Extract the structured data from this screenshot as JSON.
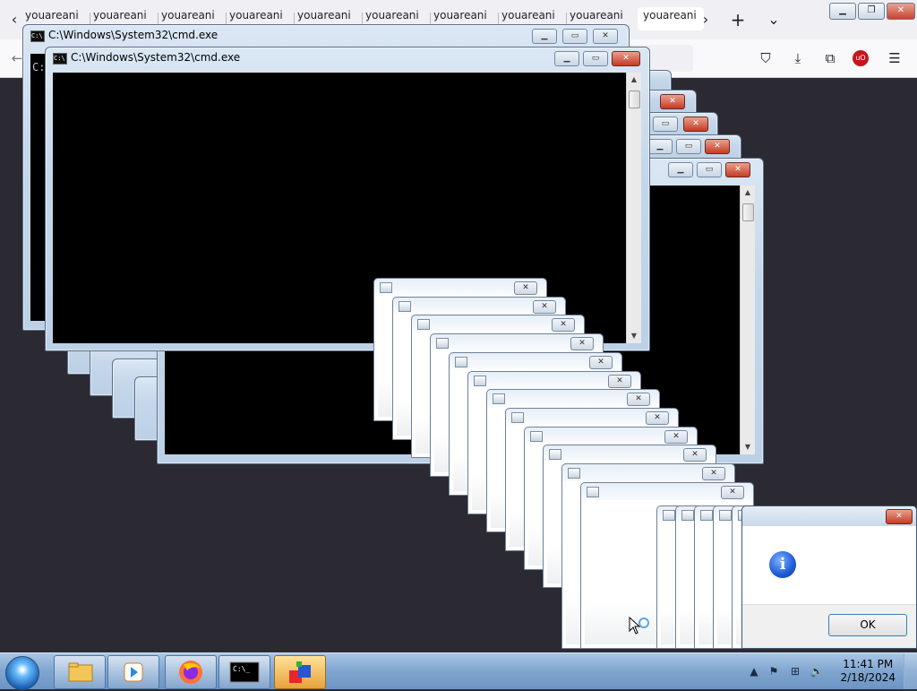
{
  "browser": {
    "tabs": [
      "youareani",
      "youareani",
      "youareani",
      "youareani",
      "youareani",
      "youareani",
      "youareani",
      "youareani",
      "youareani",
      "youareani"
    ],
    "tab_active_index": 9,
    "icons": {
      "back": "chevron-left",
      "forward": "chevron-right",
      "new_tab": "plus",
      "list_all_tabs": "chevron-down",
      "pocket": "pocket",
      "downloads": "download",
      "extensions": "puzzle",
      "ublock": "ublock-origin",
      "menu": "hamburger"
    },
    "ublock_label": "uO"
  },
  "cmd_windows": [
    {
      "title": "C:\\Windows\\System32\\cmd.exe",
      "prompt": "C:"
    },
    {
      "title": "C:\\Windows\\System32\\cmd.exe"
    }
  ],
  "dialog": {
    "ok_label": "OK",
    "icon": "information-icon"
  },
  "taskbar": {
    "items": [
      "start-orb",
      "windows-explorer",
      "media-player",
      "firefox",
      "command-prompt",
      "app-cube"
    ],
    "active_index": 5,
    "time": "11:41 PM",
    "date": "2/18/2024"
  },
  "colors": {
    "desktop": "#2b2a33",
    "console": "#000000",
    "taskbar": "#7fa5cf",
    "close_button": "#c7432f"
  }
}
